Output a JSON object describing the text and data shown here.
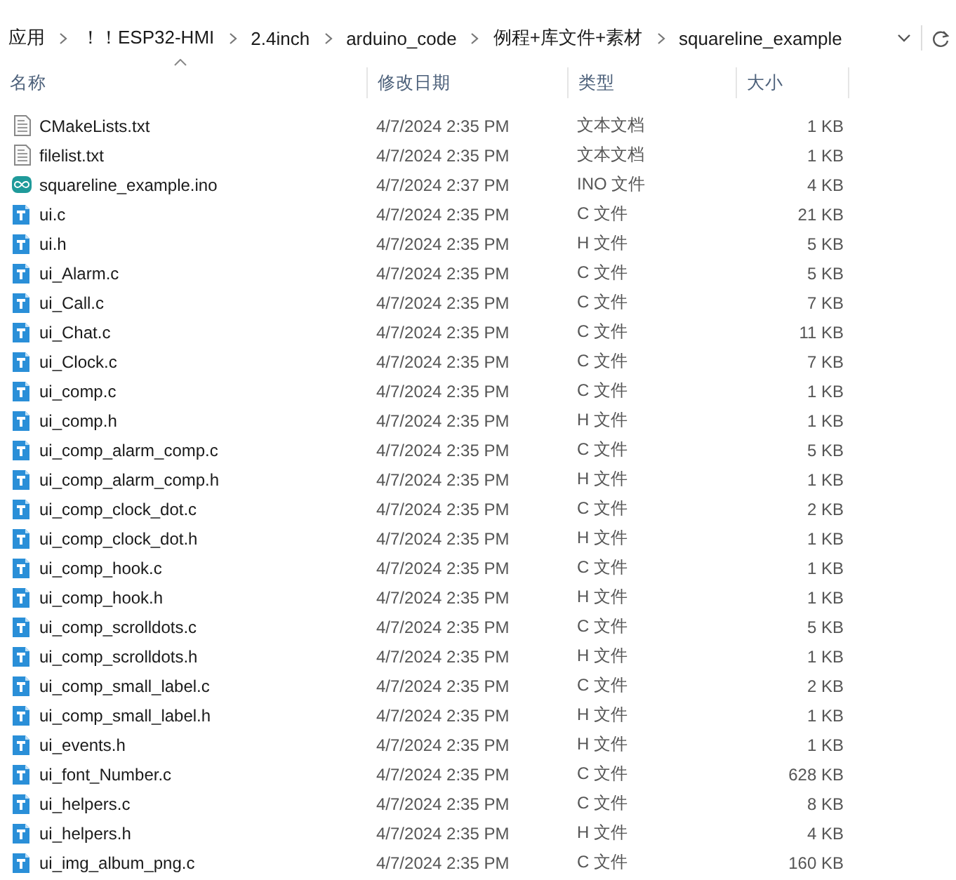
{
  "address_bar": {
    "crumbs": [
      "应用",
      "！！ESP32-HMI",
      "2.4inch",
      "arduino_code",
      "例程+库文件+素材",
      "squareline_example"
    ]
  },
  "columns": [
    {
      "label": "名称",
      "sorted": true
    },
    {
      "label": "修改日期",
      "sorted": false
    },
    {
      "label": "类型",
      "sorted": false
    },
    {
      "label": "大小",
      "sorted": false
    }
  ],
  "files": [
    {
      "name": "CMakeLists.txt",
      "kind": "text",
      "modified": "4/7/2024 2:35 PM",
      "type": "文本文档",
      "size": "1 KB"
    },
    {
      "name": "filelist.txt",
      "kind": "text",
      "modified": "4/7/2024 2:35 PM",
      "type": "文本文档",
      "size": "1 KB"
    },
    {
      "name": "squareline_example.ino",
      "kind": "arduino",
      "modified": "4/7/2024 2:37 PM",
      "type": "INO 文件",
      "size": "4 KB"
    },
    {
      "name": "ui.c",
      "kind": "source",
      "modified": "4/7/2024 2:35 PM",
      "type": "C 文件",
      "size": "21 KB"
    },
    {
      "name": "ui.h",
      "kind": "source",
      "modified": "4/7/2024 2:35 PM",
      "type": "H 文件",
      "size": "5 KB"
    },
    {
      "name": "ui_Alarm.c",
      "kind": "source",
      "modified": "4/7/2024 2:35 PM",
      "type": "C 文件",
      "size": "5 KB"
    },
    {
      "name": "ui_Call.c",
      "kind": "source",
      "modified": "4/7/2024 2:35 PM",
      "type": "C 文件",
      "size": "7 KB"
    },
    {
      "name": "ui_Chat.c",
      "kind": "source",
      "modified": "4/7/2024 2:35 PM",
      "type": "C 文件",
      "size": "11 KB"
    },
    {
      "name": "ui_Clock.c",
      "kind": "source",
      "modified": "4/7/2024 2:35 PM",
      "type": "C 文件",
      "size": "7 KB"
    },
    {
      "name": "ui_comp.c",
      "kind": "source",
      "modified": "4/7/2024 2:35 PM",
      "type": "C 文件",
      "size": "1 KB"
    },
    {
      "name": "ui_comp.h",
      "kind": "source",
      "modified": "4/7/2024 2:35 PM",
      "type": "H 文件",
      "size": "1 KB"
    },
    {
      "name": "ui_comp_alarm_comp.c",
      "kind": "source",
      "modified": "4/7/2024 2:35 PM",
      "type": "C 文件",
      "size": "5 KB"
    },
    {
      "name": "ui_comp_alarm_comp.h",
      "kind": "source",
      "modified": "4/7/2024 2:35 PM",
      "type": "H 文件",
      "size": "1 KB"
    },
    {
      "name": "ui_comp_clock_dot.c",
      "kind": "source",
      "modified": "4/7/2024 2:35 PM",
      "type": "C 文件",
      "size": "2 KB"
    },
    {
      "name": "ui_comp_clock_dot.h",
      "kind": "source",
      "modified": "4/7/2024 2:35 PM",
      "type": "H 文件",
      "size": "1 KB"
    },
    {
      "name": "ui_comp_hook.c",
      "kind": "source",
      "modified": "4/7/2024 2:35 PM",
      "type": "C 文件",
      "size": "1 KB"
    },
    {
      "name": "ui_comp_hook.h",
      "kind": "source",
      "modified": "4/7/2024 2:35 PM",
      "type": "H 文件",
      "size": "1 KB"
    },
    {
      "name": "ui_comp_scrolldots.c",
      "kind": "source",
      "modified": "4/7/2024 2:35 PM",
      "type": "C 文件",
      "size": "5 KB"
    },
    {
      "name": "ui_comp_scrolldots.h",
      "kind": "source",
      "modified": "4/7/2024 2:35 PM",
      "type": "H 文件",
      "size": "1 KB"
    },
    {
      "name": "ui_comp_small_label.c",
      "kind": "source",
      "modified": "4/7/2024 2:35 PM",
      "type": "C 文件",
      "size": "2 KB"
    },
    {
      "name": "ui_comp_small_label.h",
      "kind": "source",
      "modified": "4/7/2024 2:35 PM",
      "type": "H 文件",
      "size": "1 KB"
    },
    {
      "name": "ui_events.h",
      "kind": "source",
      "modified": "4/7/2024 2:35 PM",
      "type": "H 文件",
      "size": "1 KB"
    },
    {
      "name": "ui_font_Number.c",
      "kind": "source",
      "modified": "4/7/2024 2:35 PM",
      "type": "C 文件",
      "size": "628 KB"
    },
    {
      "name": "ui_helpers.c",
      "kind": "source",
      "modified": "4/7/2024 2:35 PM",
      "type": "C 文件",
      "size": "8 KB"
    },
    {
      "name": "ui_helpers.h",
      "kind": "source",
      "modified": "4/7/2024 2:35 PM",
      "type": "H 文件",
      "size": "4 KB"
    },
    {
      "name": "ui_img_album_png.c",
      "kind": "source",
      "modified": "4/7/2024 2:35 PM",
      "type": "C 文件",
      "size": "160 KB"
    }
  ]
}
